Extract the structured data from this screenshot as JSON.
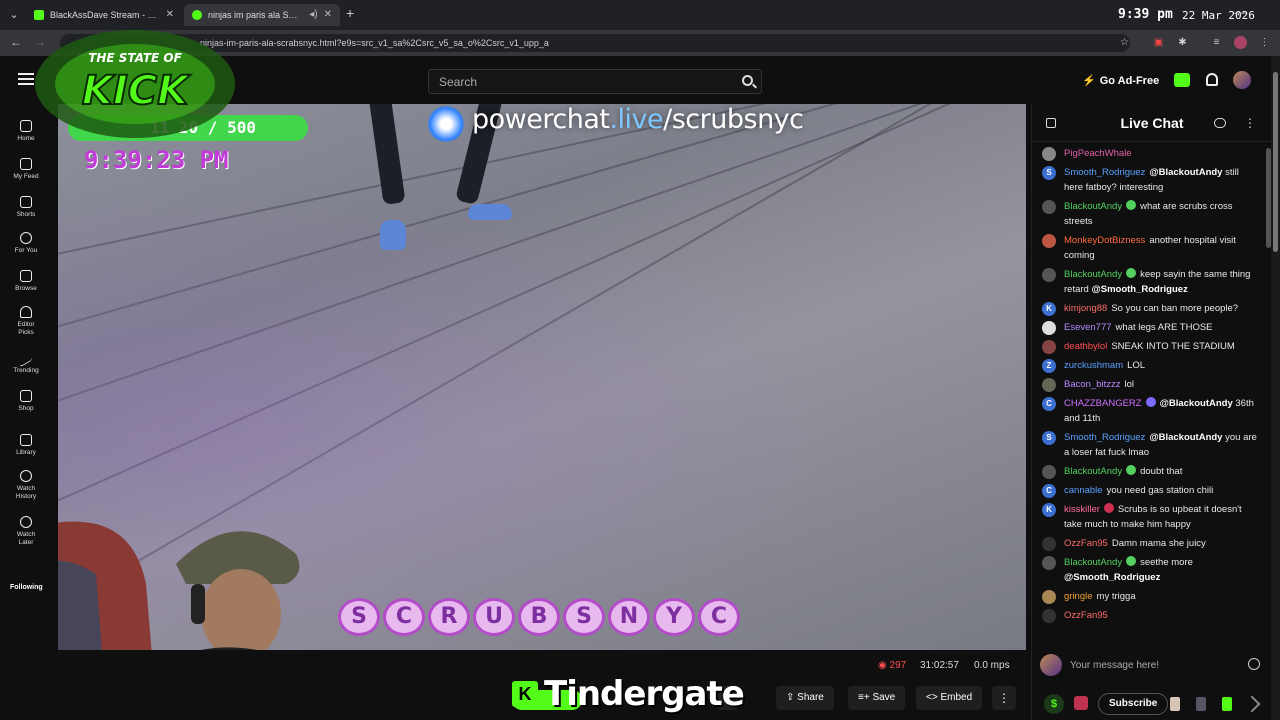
{
  "browser": {
    "tabs": [
      {
        "title": "BlackAssDave Stream - Watch L",
        "favicon_color": "#53fc18"
      },
      {
        "title": "ninjas im paris ala SCRABSN",
        "favicon_color": "#53fc18"
      }
    ],
    "url": "ninjas-im-paris-ala-scrabsnyc.html?e9s=src_v1_sa%2Csrc_v5_sa_o%2Csrc_v1_upp_a",
    "clock": "9:39 pm",
    "date": "22 Mar 2026"
  },
  "header": {
    "search_placeholder": "Search",
    "adfree_label": "Go Ad-Free"
  },
  "leftnav": {
    "items": [
      {
        "label": "Home"
      },
      {
        "label": "My Feed"
      },
      {
        "label": "Shorts"
      },
      {
        "label": "For You"
      },
      {
        "label": "Browse"
      },
      {
        "label": "Editor Picks"
      },
      {
        "label": "Trending"
      },
      {
        "label": "Shop"
      },
      {
        "label": "Library"
      },
      {
        "label": "Watch History"
      },
      {
        "label": "Watch Later"
      }
    ],
    "following_label": "Following"
  },
  "video": {
    "overlay_logo": "THE STATE OF KICK",
    "counter": "11 20 / 500",
    "overlay_clock": "9:39:23 PM",
    "powerchat_prefix": "powerchat",
    "powerchat_live": ".live",
    "powerchat_suffix": "/scrubsnyc",
    "scrubs_letters": [
      "S",
      "C",
      "R",
      "U",
      "B",
      "S",
      "N",
      "Y",
      "C"
    ]
  },
  "player": {
    "viewers": "297",
    "uptime": "31:02:57",
    "mps": "0.0 mps",
    "tindergate": "Tindergate",
    "btn_partial": "ts",
    "share_label": "Share",
    "save_label": "Save",
    "embed_label": "Embed"
  },
  "chat": {
    "title": "Live Chat",
    "input_placeholder": "Your message here!",
    "subscribe_label": "Subscribe",
    "messages": [
      {
        "user": "PigPeachWhale",
        "color": "#e060a8",
        "text": "",
        "avatar": "#888",
        "initial": ""
      },
      {
        "user": "Smooth_Rodriguez",
        "color": "#5aa0ff",
        "mention": "@BlackoutAndy",
        "text": "still here fatboy? interesting",
        "avatar": "#3b6fd0",
        "initial": "S"
      },
      {
        "user": "BlackoutAndy",
        "color": "#53d060",
        "text": "what are scrubs cross streets",
        "avatar": "#555",
        "initial": "",
        "badge": "#53d060"
      },
      {
        "user": "MonkeyDotBizness",
        "color": "#ff6a3d",
        "text": "another hospital visit coming",
        "avatar": "#b54",
        "initial": ""
      },
      {
        "user": "BlackoutAndy",
        "color": "#53d060",
        "text": "keep sayin the same thing retard",
        "mention_after": "@Smooth_Rodriguez",
        "avatar": "#555",
        "initial": "",
        "badge": "#53d060"
      },
      {
        "user": "kimjong88",
        "color": "#ff6a6a",
        "text": "So you can ban more people?",
        "avatar": "#3b6fd0",
        "initial": "K"
      },
      {
        "user": "Eseven777",
        "color": "#b38cff",
        "text": "what legs ARE THOSE",
        "avatar": "#ddd",
        "initial": ""
      },
      {
        "user": "deathbylol",
        "color": "#ff5050",
        "text": "SNEAK INTO THE STADIUM",
        "avatar": "#844",
        "initial": ""
      },
      {
        "user": "zurckushmam",
        "color": "#5aa0ff",
        "text": "LOL",
        "avatar": "#3b6fd0",
        "initial": "Z"
      },
      {
        "user": "Bacon_bitzzz",
        "color": "#b38cff",
        "text": "lol",
        "avatar": "#665",
        "initial": ""
      },
      {
        "user": "CHAZZBANGERZ",
        "color": "#d070ff",
        "mention": "@BlackoutAndy",
        "text": "36th and 11th",
        "avatar": "#3b6fd0",
        "initial": "C",
        "badge": "#7a6cff"
      },
      {
        "user": "Smooth_Rodriguez",
        "color": "#5aa0ff",
        "mention": "@BlackoutAndy",
        "text": "you are a loser fat fuck lmao",
        "avatar": "#3b6fd0",
        "initial": "S"
      },
      {
        "user": "BlackoutAndy",
        "color": "#53d060",
        "text": "doubt that",
        "avatar": "#555",
        "initial": "",
        "badge": "#53d060"
      },
      {
        "user": "cannable",
        "color": "#5aa0ff",
        "text": "you need gas station chili",
        "avatar": "#3b6fd0",
        "initial": "C"
      },
      {
        "user": "kisskiller",
        "color": "#ff6a9a",
        "text": "Scrubs is so upbeat it doesn't take much to make him happy",
        "avatar": "#3b6fd0",
        "initial": "K",
        "badge": "#d03050"
      },
      {
        "user": "OzzFan95",
        "color": "#ff6a6a",
        "text": "Damn mama she juicy",
        "avatar": "#333",
        "initial": ""
      },
      {
        "user": "BlackoutAndy",
        "color": "#53d060",
        "text": "seethe more",
        "mention_after": "@Smooth_Rodriguez",
        "avatar": "#555",
        "initial": "",
        "badge": "#53d060"
      },
      {
        "user": "gringle",
        "color": "#f0a030",
        "text": "my trigga",
        "avatar": "#a85",
        "initial": ""
      },
      {
        "user": "OzzFan95",
        "color": "#ff6a6a",
        "text": "",
        "avatar": "#333",
        "initial": ""
      }
    ]
  }
}
